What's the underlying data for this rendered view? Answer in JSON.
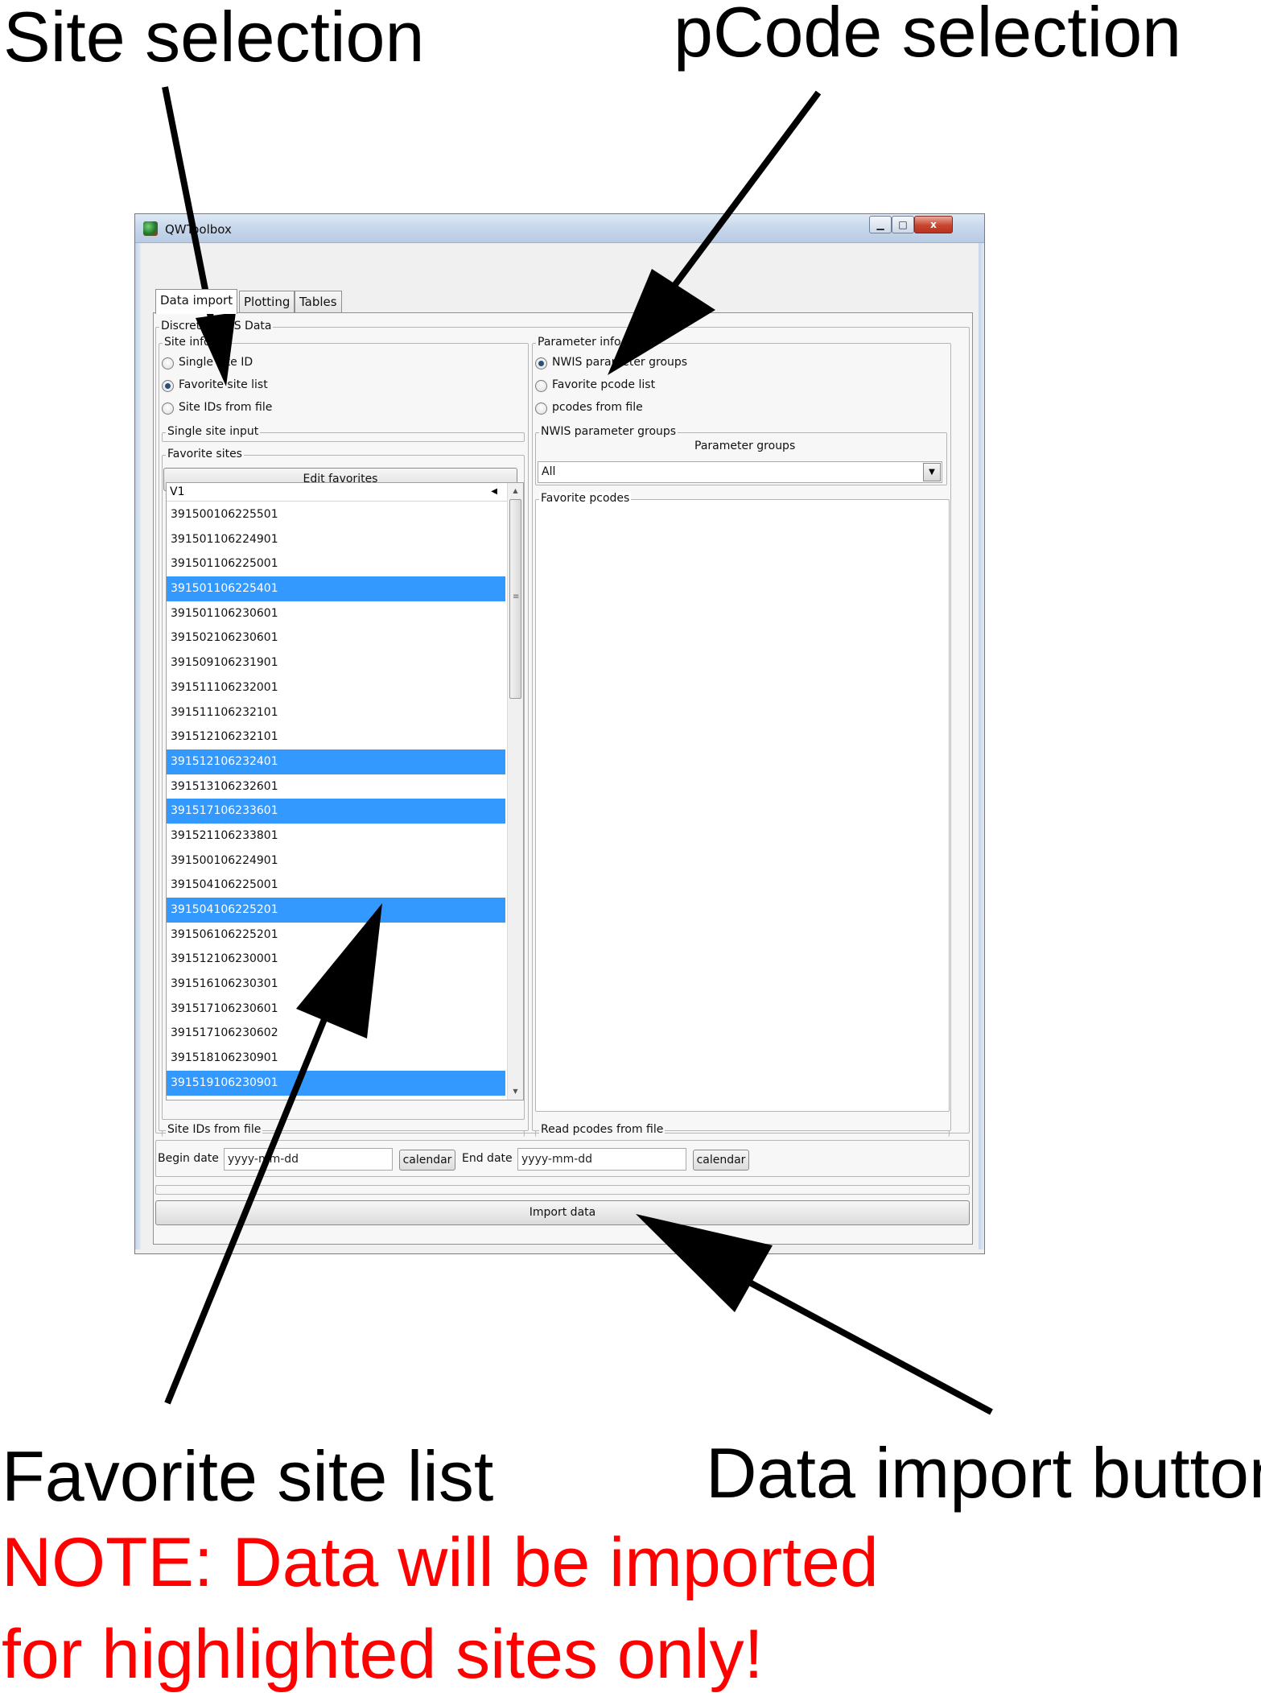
{
  "callouts": {
    "site_selection": "Site selection",
    "pcode_selection": "pCode selection",
    "favorite_site_list": "Favorite site list",
    "data_import_button": "Data import button",
    "note_line1": "NOTE: Data will be imported",
    "note_line2": "for highlighted sites only!"
  },
  "window": {
    "title": "QWToolbox",
    "controls": {
      "minimize": "▁",
      "maximize": "□",
      "close": "x"
    }
  },
  "tabs": [
    "Data import",
    "Plotting",
    "Tables"
  ],
  "discrete_group_title": "Discrete NWIS Data",
  "site_info": {
    "title": "Site info",
    "options": [
      {
        "label": "Single site ID",
        "selected": false
      },
      {
        "label": "Favorite site list",
        "selected": true
      },
      {
        "label": "Site IDs from file",
        "selected": false
      }
    ],
    "single_site_input_title": "Single site input",
    "favorite_sites_title": "Favorite sites",
    "edit_favorites_label": "Edit favorites",
    "site_ids_from_file_title": "Site IDs from file"
  },
  "site_list": {
    "column_header": "V1",
    "rows": [
      {
        "id": "391500106225501",
        "selected": false
      },
      {
        "id": "391501106224901",
        "selected": false
      },
      {
        "id": "391501106225001",
        "selected": false
      },
      {
        "id": "391501106225401",
        "selected": true
      },
      {
        "id": "391501106230601",
        "selected": false
      },
      {
        "id": "391502106230601",
        "selected": false
      },
      {
        "id": "391509106231901",
        "selected": false
      },
      {
        "id": "391511106232001",
        "selected": false
      },
      {
        "id": "391511106232101",
        "selected": false
      },
      {
        "id": "391512106232101",
        "selected": false
      },
      {
        "id": "391512106232401",
        "selected": true
      },
      {
        "id": "391513106232601",
        "selected": false
      },
      {
        "id": "391517106233601",
        "selected": true
      },
      {
        "id": "391521106233801",
        "selected": false
      },
      {
        "id": "391500106224901",
        "selected": false
      },
      {
        "id": "391504106225001",
        "selected": false
      },
      {
        "id": "391504106225201",
        "selected": true
      },
      {
        "id": "391506106225201",
        "selected": false
      },
      {
        "id": "391512106230001",
        "selected": false
      },
      {
        "id": "391516106230301",
        "selected": false
      },
      {
        "id": "391517106230601",
        "selected": false
      },
      {
        "id": "391517106230602",
        "selected": false
      },
      {
        "id": "391518106230901",
        "selected": false
      },
      {
        "id": "391519106230901",
        "selected": true
      }
    ]
  },
  "parameter_info": {
    "title": "Parameter info",
    "options": [
      {
        "label": "NWIS parameter groups",
        "selected": true
      },
      {
        "label": "Favorite pcode list",
        "selected": false
      },
      {
        "label": "pcodes from file",
        "selected": false
      }
    ],
    "nwis_groups_title": "NWIS parameter groups",
    "parameter_groups_label": "Parameter groups",
    "parameter_groups_value": "All",
    "favorite_pcodes_title": "Favorite pcodes",
    "read_pcodes_title": "Read pcodes from file"
  },
  "dates": {
    "begin_label": "Begin date",
    "begin_placeholder": "yyyy-mm-dd",
    "end_label": "End date",
    "end_placeholder": "yyyy-mm-dd",
    "calendar_label": "calendar"
  },
  "import_button_label": "Import data",
  "colors": {
    "selection": "#3399ff",
    "note_text": "#ff0000"
  }
}
